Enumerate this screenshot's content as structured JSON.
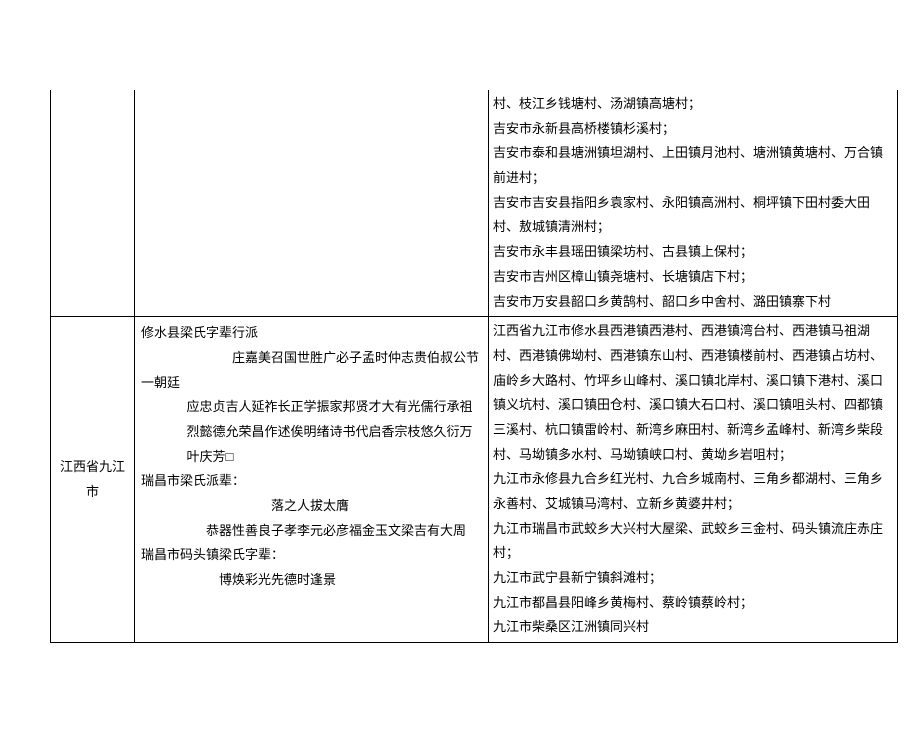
{
  "row1": {
    "c3_lines": [
      "村、枝江乡钱塘村、汤湖镇高塘村；",
      "吉安市永新县高桥楼镇杉溪村；",
      "吉安市泰和县塘洲镇坦湖村、上田镇月池村、塘洲镇黄塘村、万合镇前进村；",
      "吉安市吉安县指阳乡袁家村、永阳镇高洲村、桐坪镇下田村委大田村、敖城镇清洲村；",
      "吉安市永丰县瑶田镇梁坊村、古县镇上保村；",
      "吉安市吉州区樟山镇尧塘村、长塘镇店下村；",
      "吉安市万安县韶口乡黄鹄村、韶口乡中舍村、潞田镇寨下村"
    ]
  },
  "row2": {
    "c1": "江西省九江市",
    "c2_label1": "修水县梁氏字辈行派",
    "c2_block1_l1": "庄嘉美召国世胜广必子孟时仲志贵伯叔公节一朝廷",
    "c2_block1_l2": "应忠贞吉人延祚长正学振家邦贤才大有光儒行承祖",
    "c2_block1_l3": "烈懿德允荣昌作述俟明绪诗书代启香宗枝悠久衍万",
    "c2_block1_l4": "叶庆芳□",
    "c2_label2": "瑞昌市梁氏派辈：",
    "c2_block2_l1": "落之人拔太膺",
    "c2_block2_l2": "恭器性善良子孝李元必彦福金玉文梁吉有大周",
    "c2_label3": "瑞昌市码头镇梁氏字辈：",
    "c2_block3_l1": "博焕彩光先德时逢景",
    "c3_lines": [
      "江西省九江市修水县西港镇西港村、西港镇湾台村、西港镇马祖湖村、西港镇佛坳村、西港镇东山村、西港镇楼前村、西港镇占坊村、庙岭乡大路村、竹坪乡山峰村、溪口镇北岸村、溪口镇下港村、溪口镇义坑村、溪口镇田仓村、溪口镇大石口村、溪口镇咀头村、四都镇三溪村、杭口镇雷岭村、新湾乡麻田村、新湾乡孟峰村、新湾乡柴段村、马坳镇多水村、马坳镇峡口村、黄坳乡岩咀村；",
      "九江市永修县九合乡红光村、九合乡城南村、三角乡都湖村、三角乡永善村、艾城镇马湾村、立新乡黄婆井村；",
      "九江市瑞昌市武蛟乡大兴村大屋梁、武蛟乡三金村、码头镇流庄赤庄村；",
      "九江市武宁县新宁镇斜滩村；",
      "九江市都昌县阳峰乡黄梅村、蔡岭镇蔡岭村；",
      "九江市柴桑区江洲镇同兴村"
    ]
  }
}
